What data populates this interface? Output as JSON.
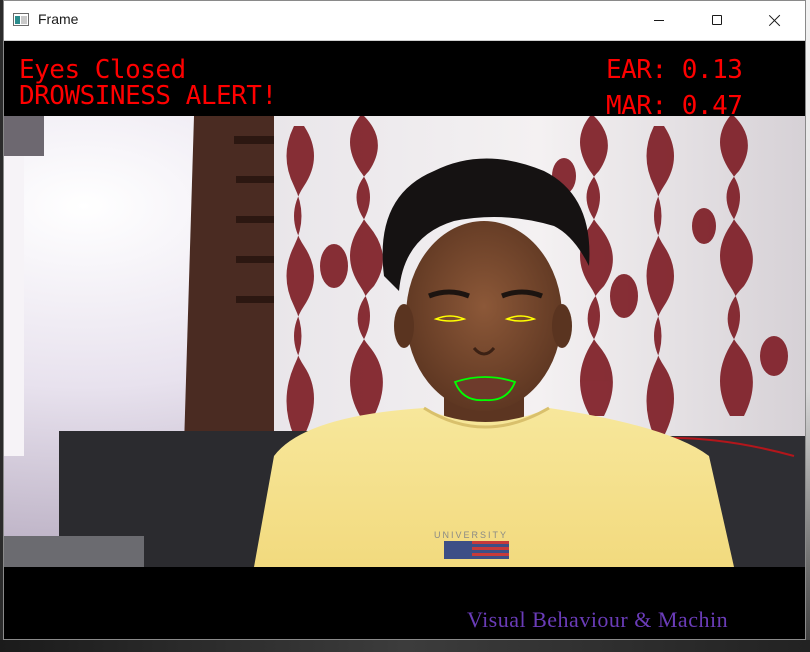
{
  "window": {
    "title": "Frame"
  },
  "overlay": {
    "status_line": "Eyes Closed",
    "alert_line": "DROWSINESS ALERT!",
    "ear_text": "EAR: 0.13",
    "mar_text": "MAR: 0.47",
    "footer_text": "Visual Behaviour & Machin"
  },
  "icons": {
    "app": "opencv-frame-icon",
    "minimize": "minimize-icon",
    "maximize": "maximize-icon",
    "close": "close-icon"
  },
  "colors": {
    "alert": "#ff0000",
    "eye_contour": "#ffff00",
    "mouth_contour": "#00ff00",
    "footer": "#6a3cb8"
  }
}
